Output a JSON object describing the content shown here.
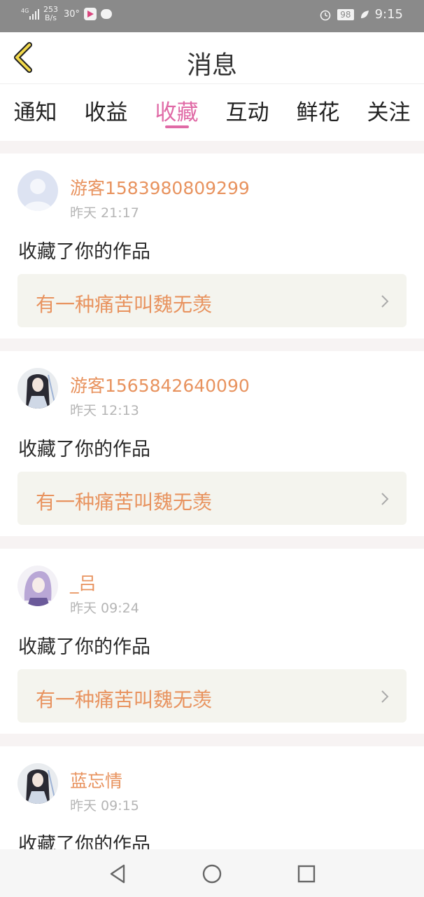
{
  "status_bar": {
    "network": "4G",
    "speed_value": "253",
    "speed_unit": "B/s",
    "temp": "30°",
    "battery": "98",
    "time": "9:15",
    "icons": [
      "signal-icon",
      "video-app-icon",
      "chat-bubble-icon",
      "alarm-icon",
      "battery-icon",
      "leaf-icon"
    ]
  },
  "header": {
    "title": "消息",
    "back_icon": "chevron-left-icon",
    "accent_color": "#e06aa6"
  },
  "tabs": [
    {
      "label": "通知",
      "active": false
    },
    {
      "label": "收益",
      "active": false
    },
    {
      "label": "收藏",
      "active": true
    },
    {
      "label": "互动",
      "active": false
    },
    {
      "label": "鲜花",
      "active": false
    },
    {
      "label": "关注",
      "active": false
    }
  ],
  "messages": [
    {
      "user": "游客1583980809299",
      "time": "昨天 21:17",
      "action": "收藏了你的作品",
      "work": "有一种痛苦叫魏无羡",
      "avatar": "default-avatar-icon"
    },
    {
      "user": "游客1565842640090",
      "time": "昨天 12:13",
      "action": "收藏了你的作品",
      "work": "有一种痛苦叫魏无羡",
      "avatar": "anime-avatar-icon"
    },
    {
      "user": "_吕",
      "time": "昨天 09:24",
      "action": "收藏了你的作品",
      "work": "有一种痛苦叫魏无羡",
      "avatar": "purple-hair-avatar-icon"
    },
    {
      "user": "蓝忘情",
      "time": "昨天 09:15",
      "action": "收藏了你的作品",
      "work": "",
      "avatar": "anime-avatar-icon"
    }
  ],
  "colors": {
    "username": "#e8935f",
    "tab_active": "#e06aa6",
    "work_bg": "#f4f4ee"
  }
}
